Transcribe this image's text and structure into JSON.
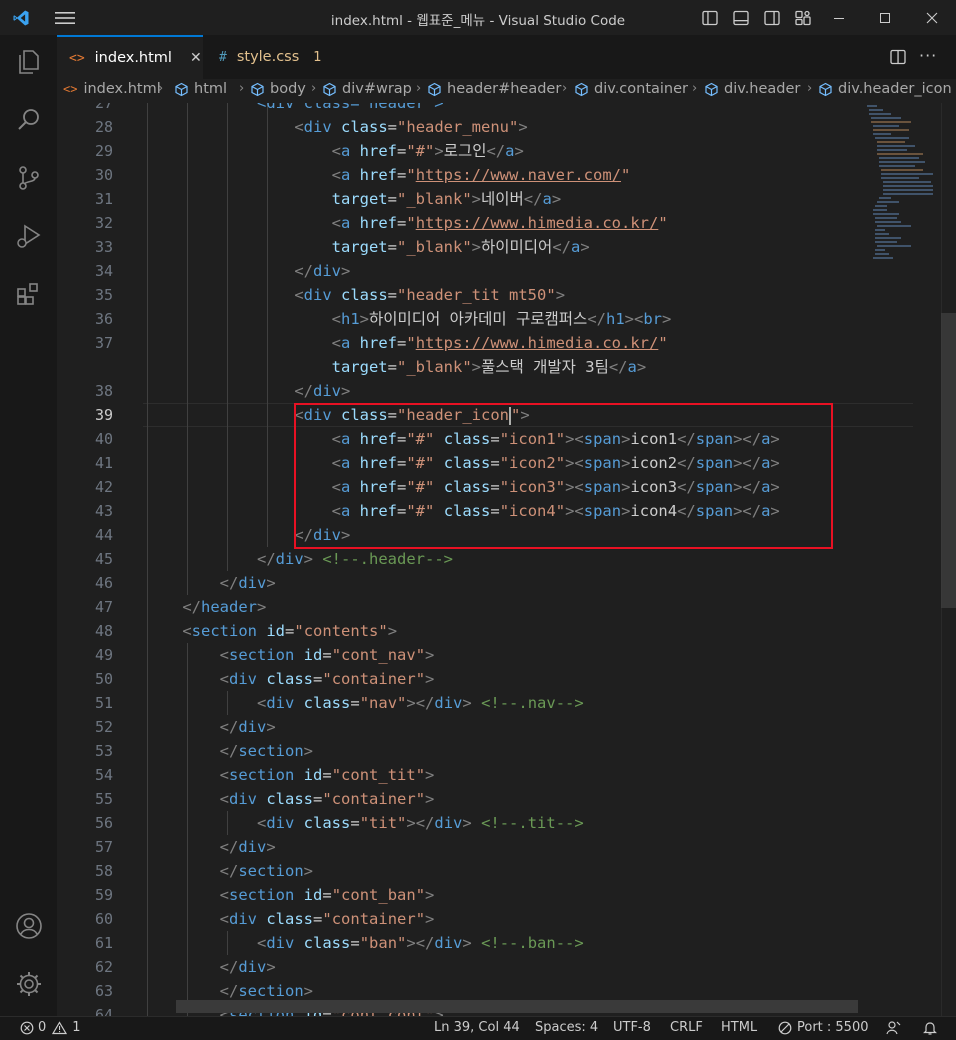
{
  "window": {
    "title": "index.html - 웹표준_메뉴 - Visual Studio Code"
  },
  "tabs": [
    {
      "icon_text": "<>",
      "label": "index.html",
      "close": "✕"
    },
    {
      "icon_text": "#",
      "label": "style.css",
      "badge": "1"
    }
  ],
  "breadcrumb": [
    "index.html",
    "html",
    "body",
    "div#wrap",
    "header#header",
    "div.container",
    "div.header",
    "div.header_icon"
  ],
  "gutter": [
    "27",
    "28",
    "29",
    "30",
    "31",
    "32",
    "33",
    "34",
    "35",
    "36",
    "37",
    "",
    "38",
    "39",
    "40",
    "41",
    "42",
    "43",
    "44",
    "45",
    "46",
    "47",
    "48",
    "49",
    "50",
    "51",
    "52",
    "53",
    "54",
    "55",
    "56",
    "57",
    "58",
    "59",
    "60",
    "61",
    "62",
    "63",
    "64"
  ],
  "code": {
    "l27": "<div class=\"header\">",
    "l28_tag": "header_menu",
    "l29_text": "로그인",
    "l30_url": "https://www.naver.com/",
    "l31_target": "_blank",
    "l31_text": "네이버",
    "l32_url": "https://www.himedia.co.kr/",
    "l33_target": "_blank",
    "l33_text": "하이미디어",
    "l35_class": "header_tit mt50",
    "l36_text": "하이미디어 아카데미 구로캠퍼스",
    "l37_url": "https://www.himedia.co.kr/",
    "l37b_target": "_blank",
    "l37b_text": "풀스택 개발자 3팀",
    "l39_class": "header_icon",
    "icons": [
      {
        "cls": "icon1",
        "text": "icon1"
      },
      {
        "cls": "icon2",
        "text": "icon2"
      },
      {
        "cls": "icon3",
        "text": "icon3"
      },
      {
        "cls": "icon4",
        "text": "icon4"
      }
    ],
    "l45_comment": "<!--.header-->",
    "l48_id": "contents",
    "l49_id": "cont_nav",
    "container": "container",
    "l51_class": "nav",
    "l51_comment": "<!--.nav-->",
    "l54_id": "cont_tit",
    "l56_class": "tit",
    "l56_comment": "<!--.tit-->",
    "l59_id": "cont_ban",
    "l61_class": "ban",
    "l61_comment": "<!--.ban-->",
    "l64_id": "cont_cont"
  },
  "status": {
    "errors": "0",
    "warnings": "1",
    "position": "Ln 39, Col 44",
    "spaces": "Spaces: 4",
    "encoding": "UTF-8",
    "eol": "CRLF",
    "language": "HTML",
    "port": "Port : 5500"
  },
  "colors": {
    "accent": "#0078d4",
    "highlight_box": "#e81123",
    "tag": "#569cd6",
    "attribute": "#9cdcfe",
    "string": "#ce9178",
    "comment": "#6a9955"
  }
}
